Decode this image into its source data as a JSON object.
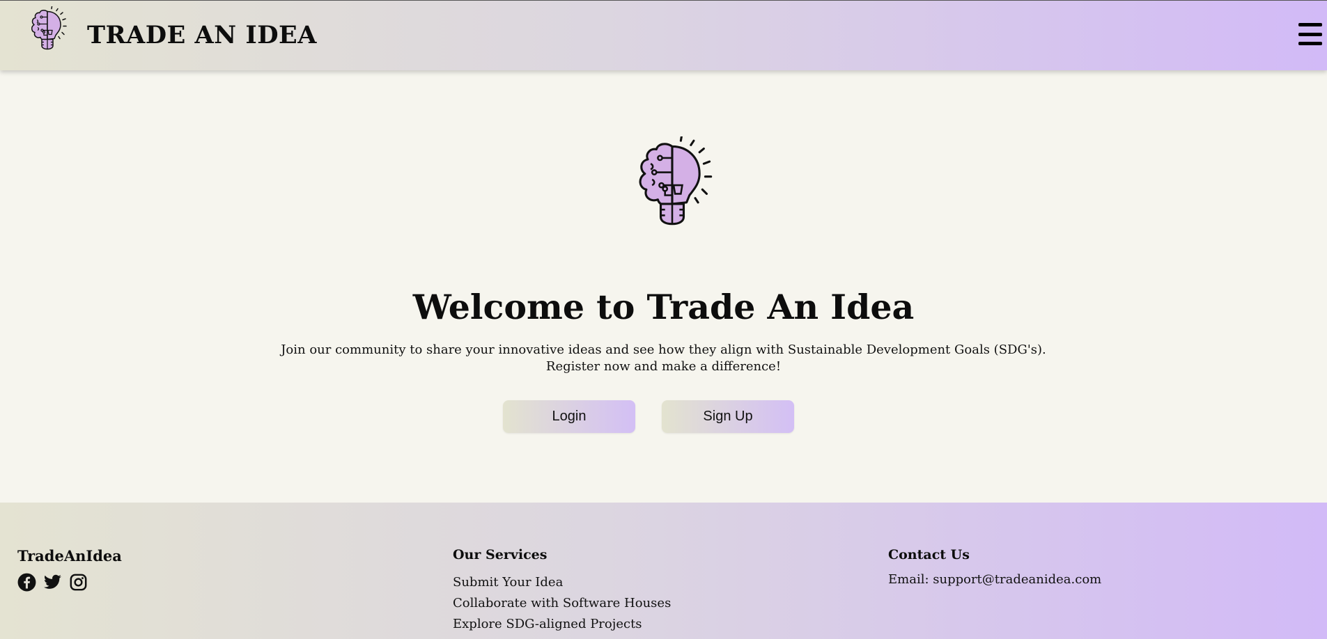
{
  "header": {
    "title": "TRADE AN IDEA",
    "logo_icon": "brain-lightbulb-icon",
    "menu_icon": "hamburger-menu-icon"
  },
  "hero": {
    "logo_icon": "brain-lightbulb-icon",
    "title": "Welcome to Trade An Idea",
    "text_line1": "Join our community to share your innovative ideas and see how they align with Sustainable Development Goals (SDG's).",
    "text_line2": "Register now and make a difference!",
    "login_label": "Login",
    "signup_label": "Sign Up"
  },
  "footer": {
    "brand": "TradeAnIdea",
    "socials": [
      "facebook-icon",
      "twitter-icon",
      "instagram-icon"
    ],
    "services_heading": "Our Services",
    "services": [
      "Submit Your Idea",
      "Collaborate with Software Houses",
      "Explore SDG-aligned Projects"
    ],
    "contact_heading": "Contact Us",
    "contact_email": "Email: support@tradeanidea.com"
  },
  "colors": {
    "background": "#f6f5ee",
    "gradient_start": "#e4e3d2",
    "gradient_end": "#d2baf7",
    "brain_fill": "#d4b0e6"
  }
}
